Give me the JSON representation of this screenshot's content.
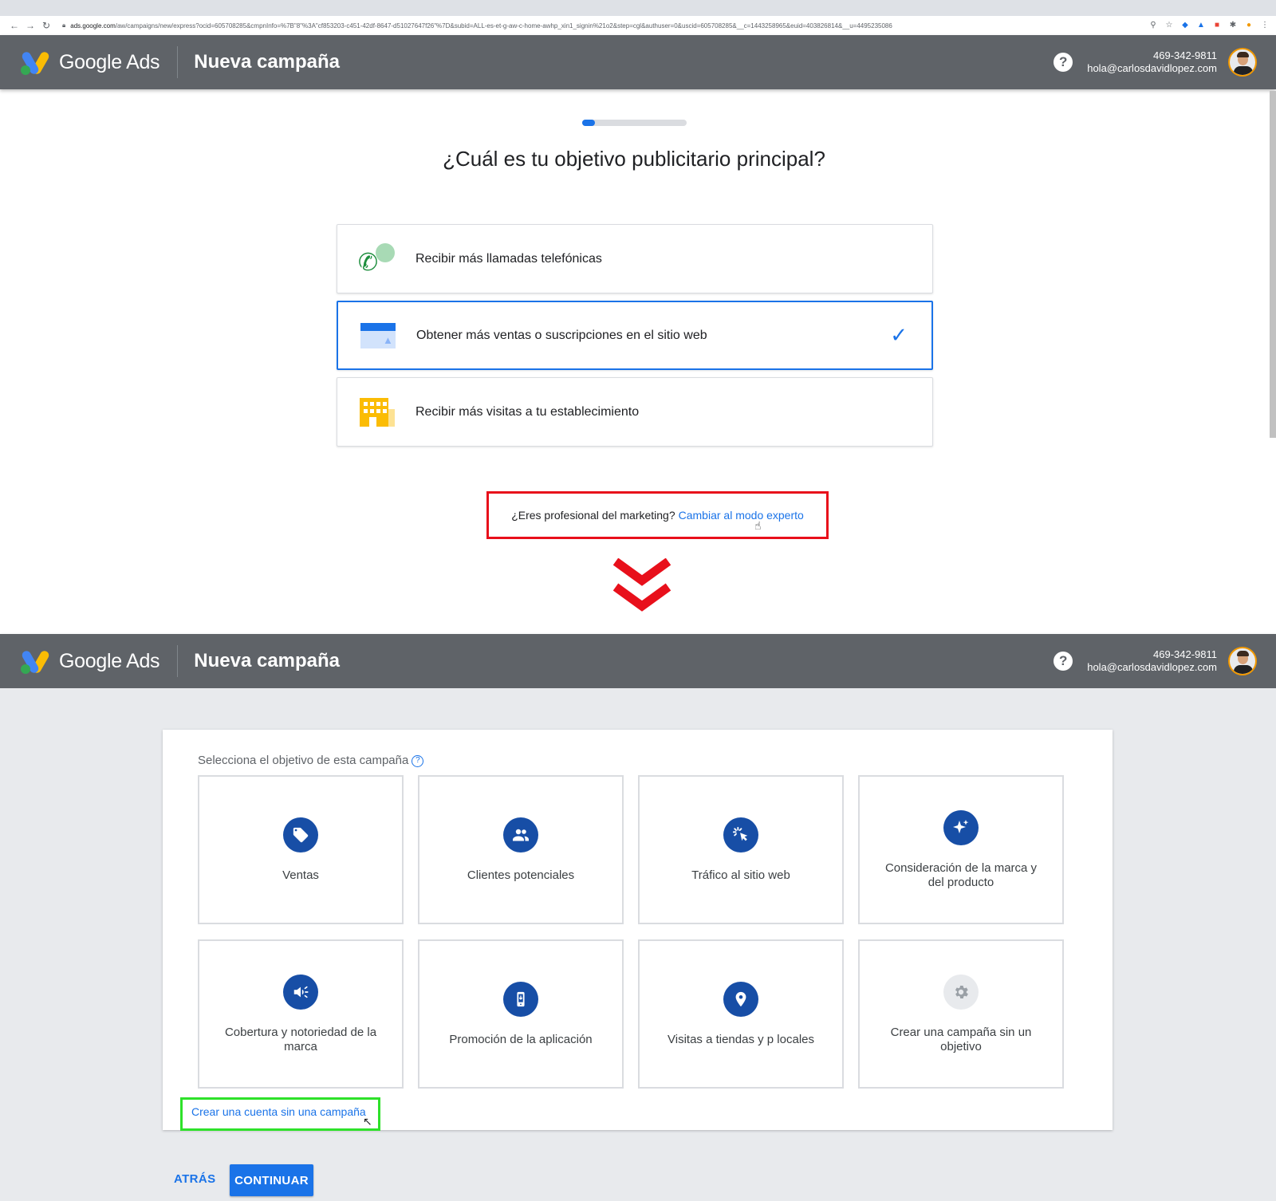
{
  "browser": {
    "url_domain": "ads.google.com",
    "url_path": "/aw/campaigns/new/express?ocid=605708285&cmpnInfo=%7B\"8\"%3A\"cf853203-c451-42df-8647-d51027647f26\"%7D&subid=ALL-es-et-g-aw-c-home-awhp_xin1_signin%21o2&step=cgl&authuser=0&uscid=605708285&__c=1443258965&euid=403826814&__u=4495235086"
  },
  "header": {
    "brand": "Google Ads",
    "page_title": "Nueva campaña",
    "phone": "469-342-9811",
    "email": "hola@carlosdavidlopez.com",
    "help_glyph": "?"
  },
  "wizard": {
    "progress_fraction": 0.12,
    "question": "¿Cuál es tu objetivo publicitario principal?",
    "options": [
      {
        "label": "Recibir más llamadas telefónicas",
        "icon": "phone-icon",
        "selected": false
      },
      {
        "label": "Obtener más ventas o suscripciones en el sitio web",
        "icon": "website-icon",
        "selected": true
      },
      {
        "label": "Recibir más visitas a tu establecimiento",
        "icon": "store-icon",
        "selected": false
      }
    ],
    "expert_prompt": "¿Eres profesional del marketing?",
    "expert_link": "Cambiar al modo experto"
  },
  "expert": {
    "section_title": "Selecciona el objetivo de esta campaña",
    "goals": [
      {
        "label": "Ventas",
        "icon": "tag-icon"
      },
      {
        "label": "Clientes potenciales",
        "icon": "people-icon"
      },
      {
        "label": "Tráfico al sitio web",
        "icon": "click-icon"
      },
      {
        "label": "Consideración de la marca y del producto",
        "icon": "sparkle-icon"
      },
      {
        "label": "Cobertura y notoriedad de la marca",
        "icon": "megaphone-icon"
      },
      {
        "label": "Promoción de la aplicación",
        "icon": "phone-app-icon"
      },
      {
        "label": "Visitas a tiendas y p locales",
        "icon": "location-pin-icon"
      },
      {
        "label": "Crear una campaña sin un objetivo",
        "icon": "gear-icon"
      }
    ],
    "no_campaign_link": "Crear una cuenta sin una campaña",
    "back_button": "ATRÁS",
    "continue_button": "CONTINUAR"
  },
  "colors": {
    "header_bg": "#5f6368",
    "accent_blue": "#1a73e8",
    "goal_icon_blue": "#174ea6",
    "highlight_red": "#e8101b",
    "highlight_green": "#2ee12a"
  }
}
